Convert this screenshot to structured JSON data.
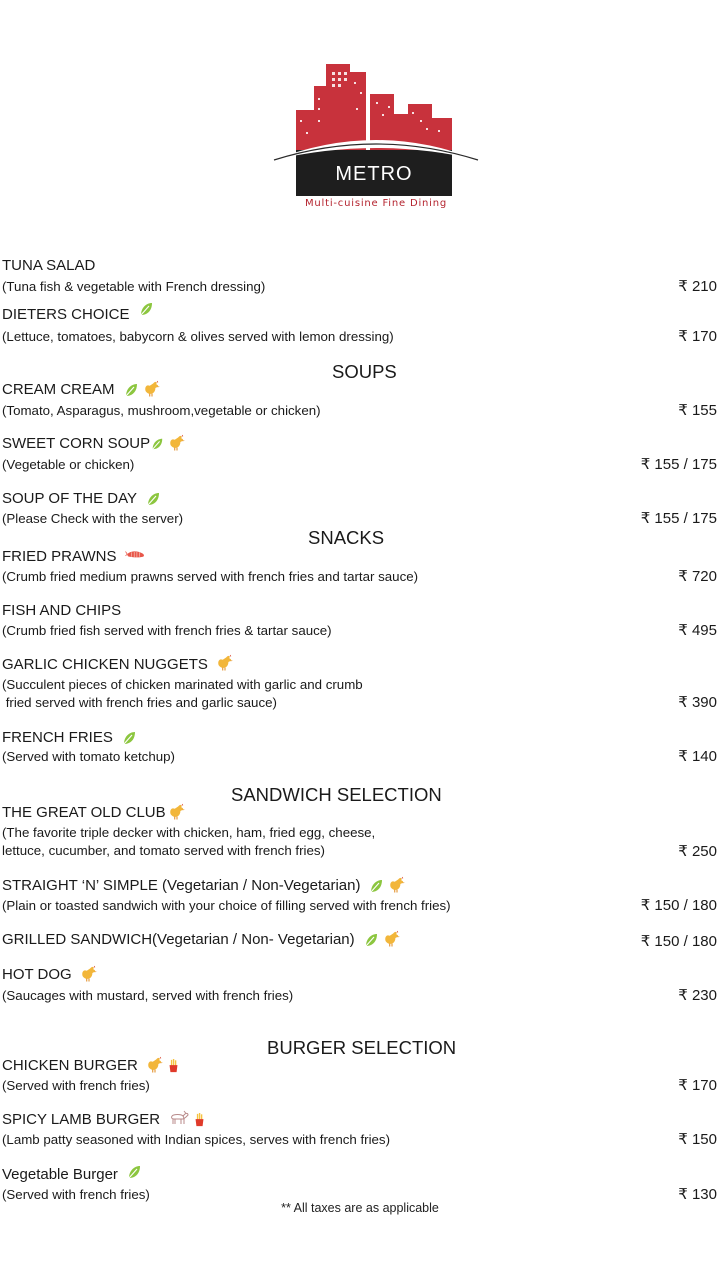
{
  "brand": {
    "name": "METRO",
    "tagline": "Multi-cuisine Fine Dining"
  },
  "colors": {
    "brand_red": "#c8323c",
    "dark": "#222222",
    "leaf_green": "#8cc63f",
    "chicken_yellow": "#f2b63a"
  },
  "sections": {
    "soups": "SOUPS",
    "snacks": "SNACKS",
    "sandwich": "SANDWICH SELECTION",
    "burger": "BURGER SELECTION"
  },
  "items": [
    {
      "name": "TUNA SALAD",
      "desc": "(Tuna fish & vegetable with French dressing)",
      "price": "₹ 210",
      "icons": []
    },
    {
      "name": "DIETERS CHOICE",
      "desc": "(Lettuce, tomatoes, babycorn & olives served with lemon dressing)",
      "price": "₹ 170",
      "icons": [
        "leaf-icon"
      ]
    },
    {
      "name": "CREAM CREAM",
      "desc": "(Tomato, Asparagus, mushroom,vegetable or chicken)",
      "price": "₹ 155",
      "icons": [
        "leaf-icon",
        "chicken-icon"
      ]
    },
    {
      "name": "SWEET CORN SOUP",
      "desc": "(Vegetable or chicken)",
      "price": "₹ 155 / 175",
      "icons": [
        "leaf-icon",
        "chicken-icon"
      ]
    },
    {
      "name": "SOUP OF THE DAY",
      "desc": "(Please Check with the server)",
      "price": "₹ 155 / 175",
      "icons": [
        "leaf-icon"
      ]
    },
    {
      "name": "FRIED PRAWNS",
      "desc": "(Crumb fried medium prawns served with french fries and tartar sauce)",
      "price": "₹ 720",
      "icons": [
        "prawn-icon"
      ]
    },
    {
      "name": "FISH AND CHIPS",
      "desc": "(Crumb fried fish served with french fries & tartar sauce)",
      "price": "₹ 495",
      "icons": []
    },
    {
      "name": "GARLIC CHICKEN NUGGETS",
      "desc": "(Succulent pieces of chicken marinated with garlic and crumb",
      "desc2": " fried served with french fries and garlic sauce)",
      "price": "₹ 390",
      "icons": [
        "chicken-icon"
      ]
    },
    {
      "name": "FRENCH FRIES",
      "desc": "(Served with tomato ketchup)",
      "price": "₹ 140",
      "icons": [
        "leaf-icon"
      ]
    },
    {
      "name": "THE GREAT OLD CLUB",
      "desc": "(The favorite triple decker with chicken, ham, fried egg, cheese,",
      "desc2": "lettuce, cucumber, and tomato served with french fries)",
      "price": "₹ 250",
      "icons": [
        "chicken-icon"
      ]
    },
    {
      "name": "STRAIGHT ‘N’ SIMPLE (Vegetarian / Non-Vegetarian)",
      "desc": "(Plain or toasted sandwich with your choice of filling served with french fries)",
      "price": "₹ 150 / 180",
      "icons": [
        "leaf-icon",
        "chicken-icon"
      ]
    },
    {
      "name": "GRILLED SANDWICH(Vegetarian / Non- Vegetarian)",
      "price": "₹ 150 / 180",
      "icons": [
        "leaf-icon",
        "chicken-icon"
      ]
    },
    {
      "name": "HOT DOG",
      "desc": "(Saucages with mustard, served with french fries)",
      "price": "₹ 230",
      "icons": [
        "chicken-icon"
      ]
    },
    {
      "name": "CHICKEN BURGER",
      "desc": "(Served with french fries)",
      "price": "₹ 170",
      "icons": [
        "chicken-icon",
        "fries-icon"
      ]
    },
    {
      "name": "SPICY LAMB BURGER",
      "desc": "(Lamb patty seasoned with Indian spices, serves with french fries)",
      "price": "₹ 150",
      "icons": [
        "goat-icon",
        "fries-icon"
      ]
    },
    {
      "name": "Vegetable Burger",
      "desc": "(Served with french fries)",
      "price": "₹ 130",
      "icons": [
        "leaf-icon"
      ]
    }
  ],
  "footnote": "** All taxes are as applicable"
}
